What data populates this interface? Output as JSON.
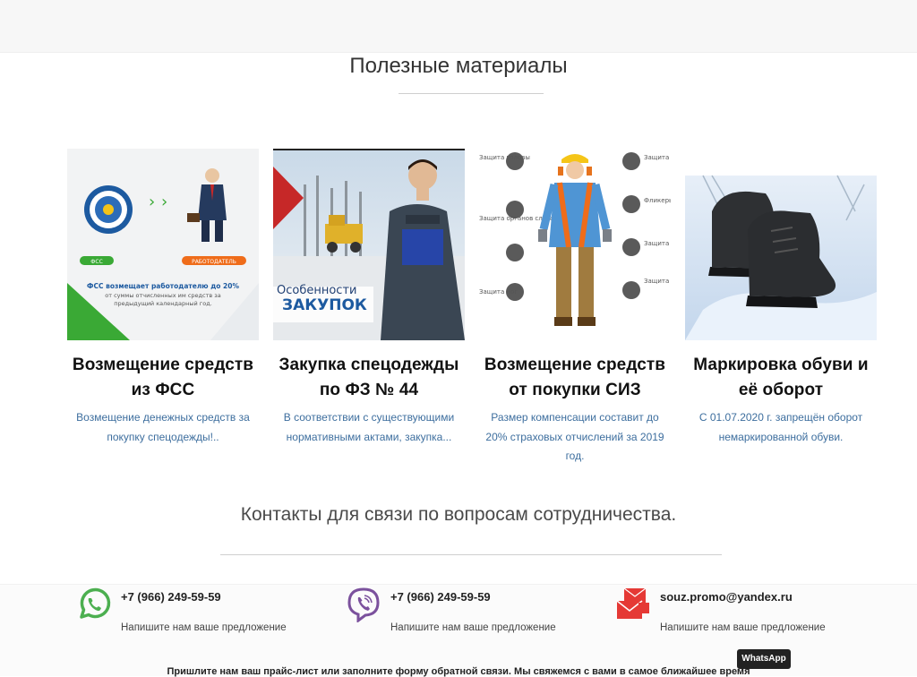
{
  "materials": {
    "title": "Полезные материалы",
    "cards": [
      {
        "title": "Возмещение средств из ФСС",
        "desc": "Возмещение денежных средств за покупку спецодежды!..",
        "img_text": {
          "left_badge": "ФСС",
          "right_badge": "РАБОТОДАТЕЛЬ",
          "caption_bold": "ФСС возмещает работодателю до 20%",
          "caption_rest": "от суммы отчисленных им средств за предыдущий календарный год."
        }
      },
      {
        "title": "Закупка спецодежды по ФЗ № 44",
        "desc": "В соответствии с существующими нормативными актами, закупка...",
        "img_text": {
          "line1": "Особенности",
          "line2": "ЗАКУПОК"
        }
      },
      {
        "title": "Возмещение средств от покупки СИЗ",
        "desc": "Размер компенсации составит до 20% страховых отчислений за 2019 год.",
        "img_text": {
          "l1": "Защита головы",
          "l2": "Защита органов слуха",
          "l3": "Защита ног",
          "r1": "Защита органов зрения",
          "r2": "Фликеры на спецодежде",
          "r3": "Защита рук",
          "r4": "Защита от падения с высоты"
        }
      },
      {
        "title": "Маркировка обуви и её оборот",
        "desc": "С 01.07.2020 г. запрещён оборот немаркированной обуви."
      }
    ]
  },
  "contacts": {
    "title": "Контакты для связи по вопросам сотрудничества.",
    "items": [
      {
        "icon": "whatsapp-icon",
        "main": "+7 (966) 249-59-59",
        "sub": "Напишите нам ваше предложение"
      },
      {
        "icon": "viber-icon",
        "main": "+7 (966) 249-59-59",
        "sub": "Напишите нам ваше предложение"
      },
      {
        "icon": "mail-icon",
        "main": "souz.promo@yandex.ru",
        "sub": "Напишите нам ваше предложение"
      }
    ]
  },
  "bottom_note": "Пришлите нам ваш прайс-лист или заполните форму обратной связи. Мы свяжемся с вами в самое ближайшее время",
  "whatsapp_badge": "WhatsApp",
  "colors": {
    "desc": "#3d6e9e",
    "whatsapp": "#4caf50",
    "viber": "#7b519d",
    "mail": "#e53935",
    "fss_green": "#3aa935"
  }
}
